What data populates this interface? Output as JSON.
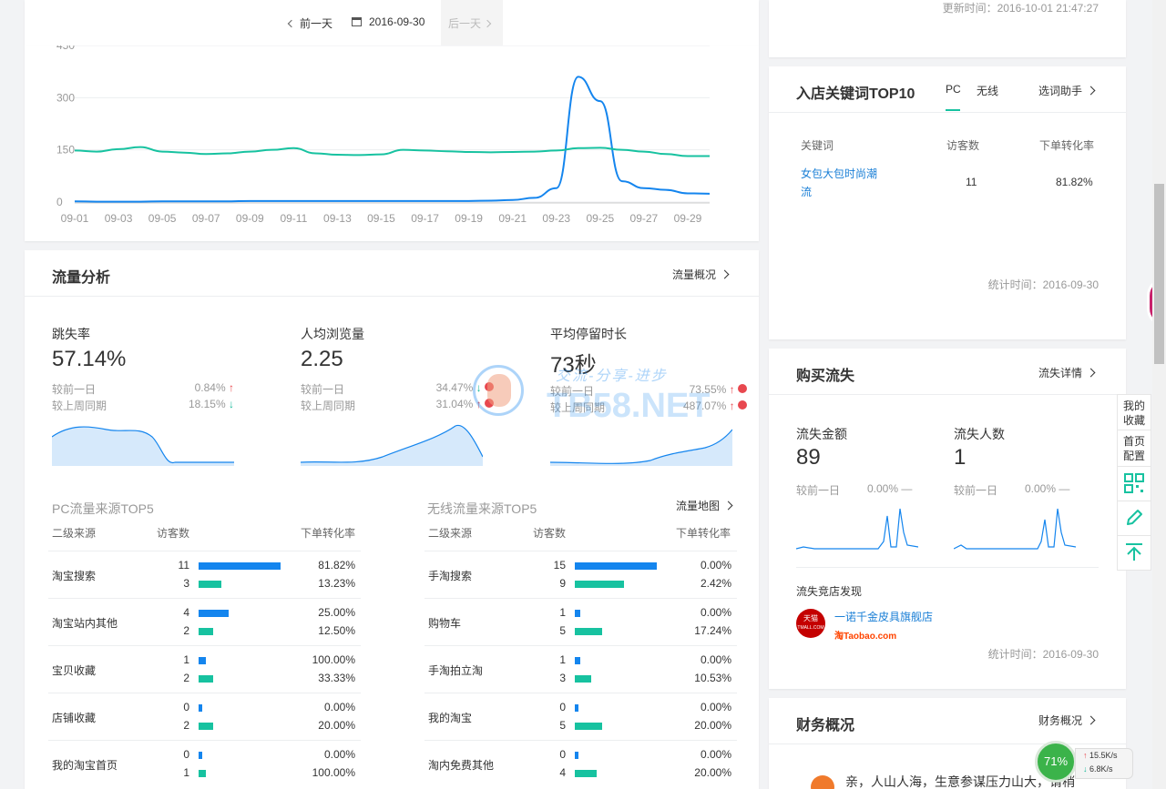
{
  "top_nav": {
    "prev_label": "前一天",
    "date": "2016-09-30",
    "next_label": "后一天"
  },
  "trend": {
    "y_ticks": [
      "450",
      "300",
      "150",
      "0"
    ],
    "x_ticks": [
      "09-01",
      "09-03",
      "09-05",
      "09-07",
      "09-09",
      "09-11",
      "09-13",
      "09-15",
      "09-17",
      "09-19",
      "09-21",
      "09-23",
      "09-25",
      "09-27",
      "09-29"
    ]
  },
  "chart_data": {
    "type": "line",
    "x": [
      "09-01",
      "09-02",
      "09-03",
      "09-04",
      "09-05",
      "09-06",
      "09-07",
      "09-08",
      "09-09",
      "09-10",
      "09-11",
      "09-12",
      "09-13",
      "09-14",
      "09-15",
      "09-16",
      "09-17",
      "09-18",
      "09-19",
      "09-20",
      "09-21",
      "09-22",
      "09-23",
      "09-24",
      "09-25",
      "09-26",
      "09-27",
      "09-28",
      "09-29",
      "09-30"
    ],
    "series": [
      {
        "color": "#1485ee",
        "values": [
          2,
          1,
          1,
          1,
          2,
          2,
          2,
          2,
          3,
          3,
          3,
          3,
          3,
          3,
          3,
          3,
          3,
          3,
          3,
          4,
          6,
          12,
          40,
          360,
          290,
          60,
          40,
          35,
          25,
          24
        ]
      },
      {
        "color": "#17c2a0",
        "values": [
          148,
          145,
          152,
          158,
          145,
          142,
          138,
          140,
          145,
          150,
          155,
          140,
          136,
          135,
          137,
          150,
          148,
          146,
          144,
          143,
          144,
          145,
          148,
          155,
          156,
          150,
          145,
          138,
          132,
          132
        ]
      }
    ],
    "ylim": [
      0,
      450
    ],
    "grid": true
  },
  "traffic": {
    "title": "流量分析",
    "link": "流量概况",
    "metrics": [
      {
        "label": "跳失率",
        "value": "57.14%",
        "day_label": "较前一日",
        "day_value": "0.84%",
        "day_dir": "↑",
        "week_label": "较上周同期",
        "week_value": "18.15%",
        "week_dir": "↓"
      },
      {
        "label": "人均浏览量",
        "value": "2.25",
        "day_label": "较前一日",
        "day_value": "34.47%",
        "day_dir": "↓",
        "week_label": "较上周同期",
        "week_value": "31.04%",
        "week_dir": "↑"
      },
      {
        "label": "平均停留时长",
        "value": "73秒",
        "day_label": "较前一日",
        "day_value": "73.55%",
        "day_dir": "↑",
        "week_label": "较上周同期",
        "week_value": "487.07%",
        "week_dir": "↑"
      }
    ],
    "watermark_1": "交流-分享-进步",
    "watermark_2": "TB58.NET",
    "pc_sources": {
      "title": "PC流量来源TOP5",
      "headers": [
        "二级来源",
        "访客数",
        "下单转化率"
      ],
      "rows": [
        {
          "name": "淘宝搜索",
          "v1": "11",
          "r1": "81.82%",
          "v2": "3",
          "r2": "13.23%",
          "f1": 11,
          "f2": 3
        },
        {
          "name": "淘宝站内其他",
          "v1": "4",
          "r1": "25.00%",
          "v2": "2",
          "r2": "12.50%",
          "f1": 4,
          "f2": 2
        },
        {
          "name": "宝贝收藏",
          "v1": "1",
          "r1": "100.00%",
          "v2": "2",
          "r2": "33.33%",
          "f1": 1,
          "f2": 2
        },
        {
          "name": "店铺收藏",
          "v1": "0",
          "r1": "0.00%",
          "v2": "2",
          "r2": "20.00%",
          "f1": 0,
          "f2": 2
        },
        {
          "name": "我的淘宝首页",
          "v1": "0",
          "r1": "0.00%",
          "v2": "1",
          "r2": "100.00%",
          "f1": 0,
          "f2": 1
        }
      ]
    },
    "mobile_sources": {
      "title": "无线流量来源TOP5",
      "link": "流量地图",
      "headers": [
        "二级来源",
        "访客数",
        "下单转化率"
      ],
      "rows": [
        {
          "name": "手淘搜索",
          "v1": "15",
          "r1": "0.00%",
          "v2": "9",
          "r2": "2.42%",
          "f1": 15,
          "f2": 9
        },
        {
          "name": "购物车",
          "v1": "1",
          "r1": "0.00%",
          "v2": "5",
          "r2": "17.24%",
          "f1": 1,
          "f2": 5
        },
        {
          "name": "手淘拍立淘",
          "v1": "1",
          "r1": "0.00%",
          "v2": "3",
          "r2": "10.53%",
          "f1": 1,
          "f2": 3
        },
        {
          "name": "我的淘宝",
          "v1": "0",
          "r1": "0.00%",
          "v2": "5",
          "r2": "20.00%",
          "f1": 0,
          "f2": 5
        },
        {
          "name": "淘内免费其他",
          "v1": "0",
          "r1": "0.00%",
          "v2": "4",
          "r2": "20.00%",
          "f1": 0,
          "f2": 4
        }
      ]
    }
  },
  "right": {
    "updated": "更新时间：2016-10-01 21:47:27",
    "keywords": {
      "title": "入店关键词TOP10",
      "tabs": [
        "PC",
        "无线"
      ],
      "link": "选词助手",
      "headers": [
        "关键词",
        "访客数",
        "下单转化率"
      ],
      "row": {
        "keyword_l1": "女包大包时尚潮",
        "keyword_l2": "流",
        "visitors": "11",
        "rate": "81.82%"
      },
      "stat": "统计时间：2016-09-30"
    },
    "loss": {
      "title": "购买流失",
      "link": "流失详情",
      "amount_label": "流失金额",
      "amount": "89",
      "amount_cmp_label": "较前一日",
      "amount_cmp": "0.00%",
      "people_label": "流失人数",
      "people": "1",
      "people_cmp_label": "较前一日",
      "people_cmp": "0.00%",
      "dash": "—",
      "competitor_label": "流失竞店发现",
      "competitor_name": "一诺千金皮具旗舰店",
      "badge_text": "天猫",
      "badge_sub": "TMALL.COM",
      "taobao_text": "淘Taobao.com",
      "stat": "统计时间：2016-09-30"
    },
    "finance": {
      "title": "财务概况",
      "link": "财务概况",
      "message": "亲，人山人海，生意参谋压力山大，请稍"
    }
  },
  "tools": {
    "favorite": "我的收藏",
    "home_config": "首页配置"
  },
  "net_widget": {
    "percent": "71%",
    "up": "15.5K/s",
    "down": "6.8K/s"
  },
  "colors": {
    "blue": "#1485ee",
    "green": "#17c2a0",
    "up": "#e8484f",
    "down": "#17b99a"
  }
}
